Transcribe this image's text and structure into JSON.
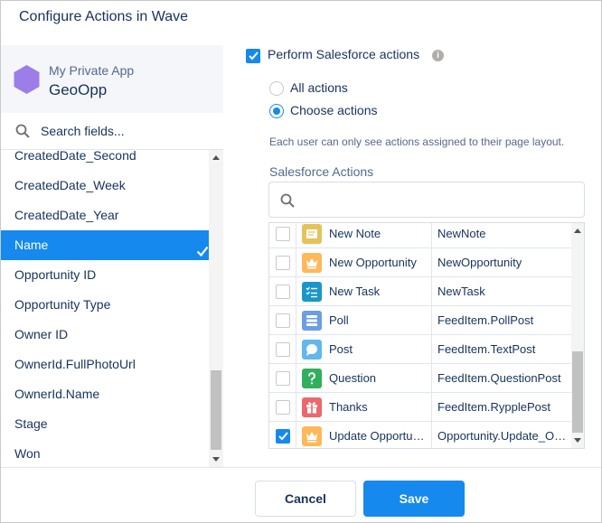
{
  "header": {
    "title": "Configure Actions in Wave"
  },
  "app": {
    "label": "My Private App",
    "name": "GeoOpp",
    "icon": "hexagon-icon",
    "icon_color": "#9d7de8"
  },
  "field_search": {
    "placeholder": "Search fields...",
    "icon": "search-icon"
  },
  "fields": [
    {
      "label": "CreatedDate_Second",
      "selected": false
    },
    {
      "label": "CreatedDate_Week",
      "selected": false
    },
    {
      "label": "CreatedDate_Year",
      "selected": false
    },
    {
      "label": "Name",
      "selected": true
    },
    {
      "label": "Opportunity ID",
      "selected": false
    },
    {
      "label": "Opportunity Type",
      "selected": false
    },
    {
      "label": "Owner ID",
      "selected": false
    },
    {
      "label": "OwnerId.FullPhotoUrl",
      "selected": false
    },
    {
      "label": "OwnerId.Name",
      "selected": false
    },
    {
      "label": "Stage",
      "selected": false
    },
    {
      "label": "Won",
      "selected": false
    }
  ],
  "perform": {
    "label": "Perform Salesforce actions",
    "checked": true,
    "info_icon": "info-icon"
  },
  "radios": {
    "all": {
      "label": "All actions",
      "selected": false
    },
    "choose": {
      "label": "Choose actions",
      "selected": true
    }
  },
  "note": "Each user can only see actions assigned to their page layout.",
  "sf_actions": {
    "label": "Salesforce Actions",
    "search_placeholder": "",
    "rows": [
      {
        "label": "New Note",
        "api": "NewNote",
        "checked": false,
        "icon": "note-icon",
        "color": "#e6c25c"
      },
      {
        "label": "New Opportunity",
        "api": "NewOpportunity",
        "checked": false,
        "icon": "crown-icon",
        "color": "#fcb95b"
      },
      {
        "label": "New Task",
        "api": "NewTask",
        "checked": false,
        "icon": "task-list-icon",
        "color": "#4bc076"
      },
      {
        "label": "Poll",
        "api": "FeedItem.PollPost",
        "checked": false,
        "icon": "poll-icon",
        "color": "#6b9ee2"
      },
      {
        "label": "Post",
        "api": "FeedItem.TextPost",
        "checked": false,
        "icon": "post-bubble-icon",
        "color": "#62b7ed"
      },
      {
        "label": "Question",
        "api": "FeedItem.QuestionPost",
        "checked": false,
        "icon": "question-icon",
        "color": "#32af5c"
      },
      {
        "label": "Thanks",
        "api": "FeedItem.RypplePost",
        "checked": false,
        "icon": "gift-icon",
        "color": "#e9696e"
      },
      {
        "label": "Update Opportunity",
        "api": "Opportunity.Update_Opportunity",
        "checked": true,
        "icon": "crown-icon",
        "color": "#fcb95b"
      }
    ]
  },
  "footer": {
    "cancel_label": "Cancel",
    "save_label": "Save"
  },
  "colors": {
    "accent": "#1589ee",
    "text": "#16325c",
    "muted": "#54698d"
  }
}
